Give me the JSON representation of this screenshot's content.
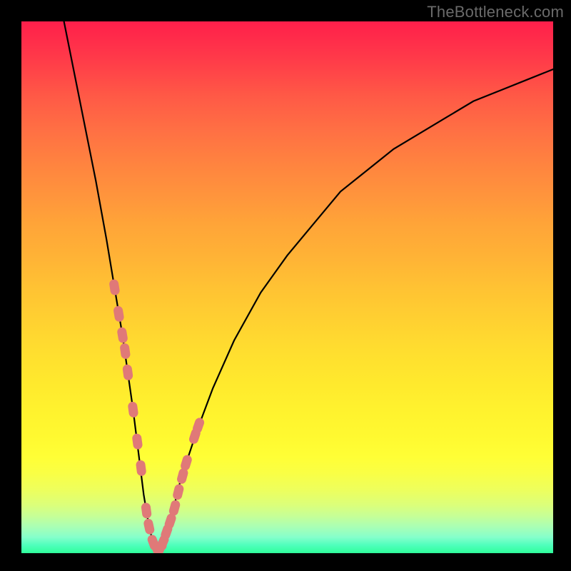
{
  "watermark": "TheBottleneck.com",
  "colors": {
    "frame": "#000000",
    "curve_stroke": "#000000",
    "marker_fill": "#e07978",
    "gradient_top": "#ff1f4b",
    "gradient_bottom": "#2fff9a"
  },
  "chart_data": {
    "type": "line",
    "title": "",
    "xlabel": "",
    "ylabel": "",
    "xlim": [
      0,
      100
    ],
    "ylim": [
      0,
      100
    ],
    "grid": false,
    "annotations": [],
    "series": [
      {
        "name": "bottleneck-curve",
        "x": [
          8,
          10,
          12,
          14,
          16,
          18,
          19,
          20,
          21,
          22,
          23,
          24,
          25,
          26,
          28,
          30,
          33,
          36,
          40,
          45,
          50,
          55,
          60,
          65,
          70,
          75,
          80,
          85,
          90,
          95,
          100
        ],
        "y": [
          100,
          90,
          80,
          70,
          59,
          47,
          41,
          34,
          27,
          19,
          11,
          5,
          1,
          1,
          6,
          14,
          23,
          31,
          40,
          49,
          56,
          62,
          68,
          72,
          76,
          79,
          82,
          85,
          87,
          89,
          91
        ]
      }
    ],
    "markers": {
      "name": "highlighted-points",
      "x": [
        17.5,
        18.3,
        19,
        19.5,
        20,
        21,
        21.8,
        22.5,
        23.5,
        24,
        24.8,
        25.5,
        26,
        26.6,
        27.3,
        28,
        28.8,
        29.5,
        30.3,
        31,
        32.6,
        33.3
      ],
      "y": [
        50,
        45,
        41,
        38,
        34,
        27,
        21,
        16,
        8,
        5,
        2,
        1,
        1,
        2,
        4,
        6,
        8.5,
        11.5,
        14.5,
        17,
        22,
        24
      ]
    }
  }
}
